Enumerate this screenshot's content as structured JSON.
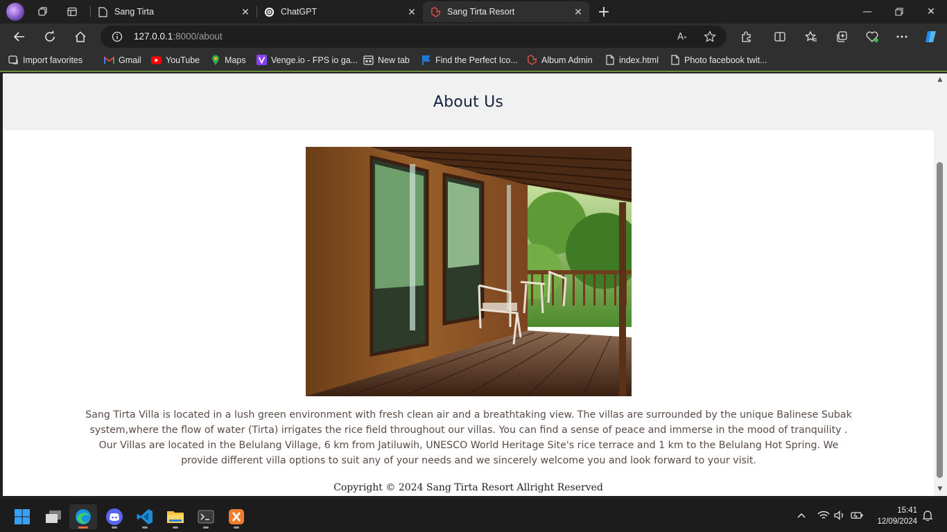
{
  "browser": {
    "tabs": [
      {
        "label": "Sang Tirta",
        "icon": "page-icon",
        "active": false
      },
      {
        "label": "ChatGPT",
        "icon": "chatgpt-icon",
        "active": false
      },
      {
        "label": "Sang Tirta Resort",
        "icon": "laravel-icon",
        "active": true
      }
    ],
    "address": {
      "host": "127.0.0.1",
      "path": ":8000/about"
    },
    "bookmarks": [
      {
        "label": "Import favorites",
        "icon": "import-icon"
      },
      {
        "label": "Gmail",
        "icon": "gmail-icon"
      },
      {
        "label": "YouTube",
        "icon": "youtube-icon"
      },
      {
        "label": "Maps",
        "icon": "maps-icon"
      },
      {
        "label": "Venge.io - FPS io ga...",
        "icon": "venge-icon"
      },
      {
        "label": "New tab",
        "icon": "newtab-icon"
      },
      {
        "label": "Find the Perfect Ico...",
        "icon": "flag-icon"
      },
      {
        "label": "Album Admin",
        "icon": "laravel-icon"
      },
      {
        "label": "index.html",
        "icon": "file-icon"
      },
      {
        "label": "Photo facebook twit...",
        "icon": "file-icon"
      }
    ]
  },
  "page": {
    "title": "About Us",
    "image_alt": "villa-veranda-photo",
    "description": "Sang Tirta Villa is located in a lush green environment with fresh clean air and a breathtaking view. The villas are surrounded by the unique Balinese Subak system,where the flow of water (Tirta) irrigates the rice field throughout our villas. You can find a sense of peace and immerse in the mood of tranquility . Our Villas are located in the Belulang Village, 6 km from Jatiluwih, UNESCO World Heritage Site's rice terrace and 1 km to the Belulang Hot Spring. We provide different villa options to suit any of your needs and we sincerely welcome you and look forward to your visit.",
    "copyright": "Copyright © 2024 Sang Tirta Resort Allright Reserved"
  },
  "taskbar": {
    "apps": [
      "windows-start-icon",
      "task-view-icon",
      "edge-icon",
      "discord-icon",
      "vscode-icon",
      "file-explorer-icon",
      "terminal-icon",
      "xampp-icon"
    ],
    "time": "15:41",
    "date": "12/09/2024"
  },
  "colors": {
    "accent_title": "#14213d",
    "header_bg": "#f1f1f1",
    "body_text": "#5a4a45"
  }
}
